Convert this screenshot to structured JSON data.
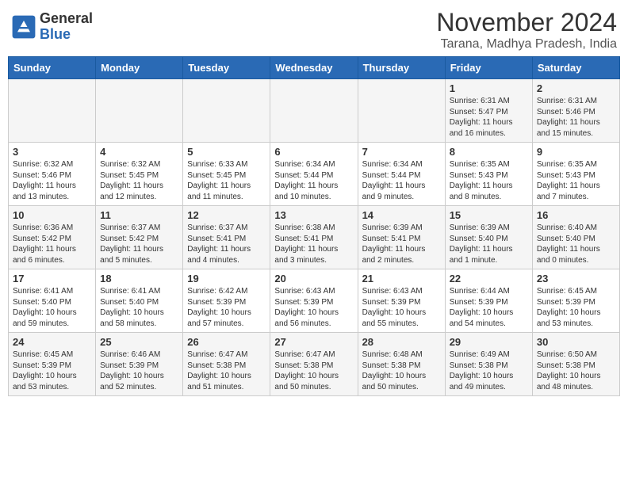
{
  "header": {
    "logo_general": "General",
    "logo_blue": "Blue",
    "month_year": "November 2024",
    "location": "Tarana, Madhya Pradesh, India"
  },
  "days_of_week": [
    "Sunday",
    "Monday",
    "Tuesday",
    "Wednesday",
    "Thursday",
    "Friday",
    "Saturday"
  ],
  "weeks": [
    [
      {
        "day": "",
        "info": ""
      },
      {
        "day": "",
        "info": ""
      },
      {
        "day": "",
        "info": ""
      },
      {
        "day": "",
        "info": ""
      },
      {
        "day": "",
        "info": ""
      },
      {
        "day": "1",
        "info": "Sunrise: 6:31 AM\nSunset: 5:47 PM\nDaylight: 11 hours and 16 minutes."
      },
      {
        "day": "2",
        "info": "Sunrise: 6:31 AM\nSunset: 5:46 PM\nDaylight: 11 hours and 15 minutes."
      }
    ],
    [
      {
        "day": "3",
        "info": "Sunrise: 6:32 AM\nSunset: 5:46 PM\nDaylight: 11 hours and 13 minutes."
      },
      {
        "day": "4",
        "info": "Sunrise: 6:32 AM\nSunset: 5:45 PM\nDaylight: 11 hours and 12 minutes."
      },
      {
        "day": "5",
        "info": "Sunrise: 6:33 AM\nSunset: 5:45 PM\nDaylight: 11 hours and 11 minutes."
      },
      {
        "day": "6",
        "info": "Sunrise: 6:34 AM\nSunset: 5:44 PM\nDaylight: 11 hours and 10 minutes."
      },
      {
        "day": "7",
        "info": "Sunrise: 6:34 AM\nSunset: 5:44 PM\nDaylight: 11 hours and 9 minutes."
      },
      {
        "day": "8",
        "info": "Sunrise: 6:35 AM\nSunset: 5:43 PM\nDaylight: 11 hours and 8 minutes."
      },
      {
        "day": "9",
        "info": "Sunrise: 6:35 AM\nSunset: 5:43 PM\nDaylight: 11 hours and 7 minutes."
      }
    ],
    [
      {
        "day": "10",
        "info": "Sunrise: 6:36 AM\nSunset: 5:42 PM\nDaylight: 11 hours and 6 minutes."
      },
      {
        "day": "11",
        "info": "Sunrise: 6:37 AM\nSunset: 5:42 PM\nDaylight: 11 hours and 5 minutes."
      },
      {
        "day": "12",
        "info": "Sunrise: 6:37 AM\nSunset: 5:41 PM\nDaylight: 11 hours and 4 minutes."
      },
      {
        "day": "13",
        "info": "Sunrise: 6:38 AM\nSunset: 5:41 PM\nDaylight: 11 hours and 3 minutes."
      },
      {
        "day": "14",
        "info": "Sunrise: 6:39 AM\nSunset: 5:41 PM\nDaylight: 11 hours and 2 minutes."
      },
      {
        "day": "15",
        "info": "Sunrise: 6:39 AM\nSunset: 5:40 PM\nDaylight: 11 hours and 1 minute."
      },
      {
        "day": "16",
        "info": "Sunrise: 6:40 AM\nSunset: 5:40 PM\nDaylight: 11 hours and 0 minutes."
      }
    ],
    [
      {
        "day": "17",
        "info": "Sunrise: 6:41 AM\nSunset: 5:40 PM\nDaylight: 10 hours and 59 minutes."
      },
      {
        "day": "18",
        "info": "Sunrise: 6:41 AM\nSunset: 5:40 PM\nDaylight: 10 hours and 58 minutes."
      },
      {
        "day": "19",
        "info": "Sunrise: 6:42 AM\nSunset: 5:39 PM\nDaylight: 10 hours and 57 minutes."
      },
      {
        "day": "20",
        "info": "Sunrise: 6:43 AM\nSunset: 5:39 PM\nDaylight: 10 hours and 56 minutes."
      },
      {
        "day": "21",
        "info": "Sunrise: 6:43 AM\nSunset: 5:39 PM\nDaylight: 10 hours and 55 minutes."
      },
      {
        "day": "22",
        "info": "Sunrise: 6:44 AM\nSunset: 5:39 PM\nDaylight: 10 hours and 54 minutes."
      },
      {
        "day": "23",
        "info": "Sunrise: 6:45 AM\nSunset: 5:39 PM\nDaylight: 10 hours and 53 minutes."
      }
    ],
    [
      {
        "day": "24",
        "info": "Sunrise: 6:45 AM\nSunset: 5:39 PM\nDaylight: 10 hours and 53 minutes."
      },
      {
        "day": "25",
        "info": "Sunrise: 6:46 AM\nSunset: 5:39 PM\nDaylight: 10 hours and 52 minutes."
      },
      {
        "day": "26",
        "info": "Sunrise: 6:47 AM\nSunset: 5:38 PM\nDaylight: 10 hours and 51 minutes."
      },
      {
        "day": "27",
        "info": "Sunrise: 6:47 AM\nSunset: 5:38 PM\nDaylight: 10 hours and 50 minutes."
      },
      {
        "day": "28",
        "info": "Sunrise: 6:48 AM\nSunset: 5:38 PM\nDaylight: 10 hours and 50 minutes."
      },
      {
        "day": "29",
        "info": "Sunrise: 6:49 AM\nSunset: 5:38 PM\nDaylight: 10 hours and 49 minutes."
      },
      {
        "day": "30",
        "info": "Sunrise: 6:50 AM\nSunset: 5:38 PM\nDaylight: 10 hours and 48 minutes."
      }
    ]
  ]
}
